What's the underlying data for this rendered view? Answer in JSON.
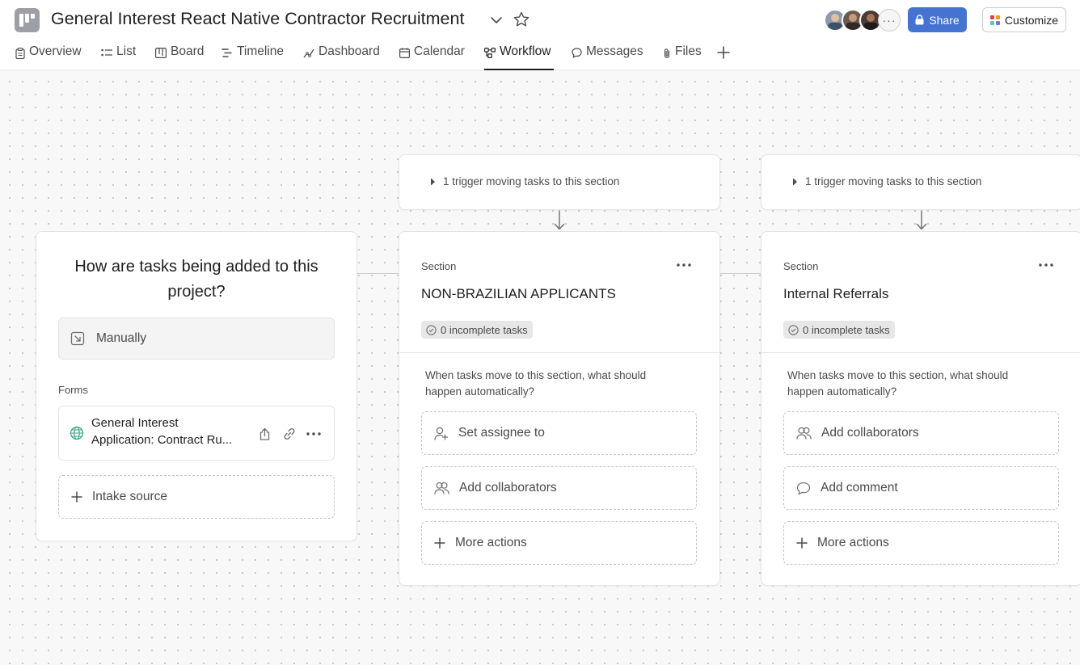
{
  "header": {
    "title": "General Interest React Native Contractor Recruitment",
    "share_label": "Share",
    "customize_label": "Customize",
    "avatar_more": "···"
  },
  "tabs": [
    {
      "label": "Overview",
      "icon": "clipboard-icon"
    },
    {
      "label": "List",
      "icon": "list-icon"
    },
    {
      "label": "Board",
      "icon": "board-icon"
    },
    {
      "label": "Timeline",
      "icon": "timeline-icon"
    },
    {
      "label": "Dashboard",
      "icon": "dashboard-icon"
    },
    {
      "label": "Calendar",
      "icon": "calendar-icon"
    },
    {
      "label": "Workflow",
      "icon": "workflow-icon",
      "active": true
    },
    {
      "label": "Messages",
      "icon": "message-icon"
    },
    {
      "label": "Files",
      "icon": "paperclip-icon"
    }
  ],
  "intake": {
    "question": "How are tasks being added to this project?",
    "manual_label": "Manually",
    "forms_label": "Forms",
    "form_line1": "General Interest",
    "form_line2": "Application: Contract Ru...",
    "intake_source_label": "Intake source"
  },
  "sections": [
    {
      "trigger": "1 trigger moving tasks to this section",
      "label": "Section",
      "name": "NON-BRAZILIAN APPLICANTS",
      "badge": "0 incomplete tasks",
      "question": "When tasks move to this section, what should happen automatically?",
      "actions": [
        "Set assignee to",
        "Add collaborators",
        "More actions"
      ]
    },
    {
      "trigger": "1 trigger moving tasks to this section",
      "label": "Section",
      "name": "Internal Referrals",
      "badge": "0 incomplete tasks",
      "question": "When tasks move to this section, what should happen automatically?",
      "actions": [
        "Add collaborators",
        "Add comment",
        "More actions"
      ]
    }
  ],
  "colors": {
    "share_blue": "#4573d2",
    "canvas_bg": "#f9f8f8",
    "form_globe": "#3aa58a"
  }
}
